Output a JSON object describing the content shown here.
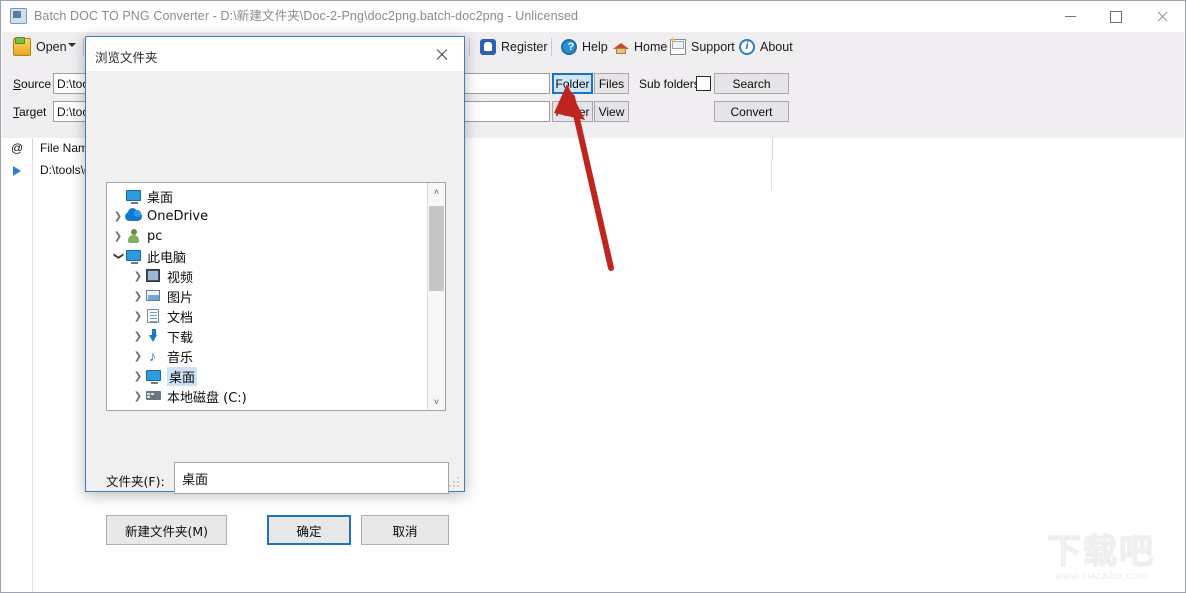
{
  "window": {
    "title": "Batch DOC TO PNG Converter - D:\\新建文件夹\\Doc-2-Png\\doc2png.batch-doc2png - Unlicensed",
    "app_icon": "app-icon",
    "controls": {
      "minimize": "minimize",
      "maximize": "maximize",
      "close": "close"
    }
  },
  "toolbar": {
    "open_label": "Open",
    "items": [
      {
        "label": "Register",
        "icon": "register-icon"
      },
      {
        "label": "Help",
        "icon": "help-icon"
      },
      {
        "label": "Home",
        "icon": "home-icon"
      },
      {
        "label": "Support",
        "icon": "support-icon"
      },
      {
        "label": "About",
        "icon": "about-icon"
      }
    ]
  },
  "params": {
    "source_label": "Source",
    "source_label_pre": "S",
    "source_label_post": "ource",
    "source_value": "D:\\tool",
    "target_label": "Target",
    "target_label_pre": "T",
    "target_label_post": "arget",
    "target_value": "D:\\tool",
    "source_folder_button": "Folder",
    "source_files_button": "Files",
    "subfolders_label": "Sub folders",
    "subfolders_checked": false,
    "search_button": "Search",
    "target_folder_button": "Folder",
    "view_button": "View",
    "convert_button": "Convert"
  },
  "file_list": {
    "columns": [
      "@",
      "File Name"
    ],
    "rows": [
      {
        "marker": "play-marker",
        "file_name": "D:\\tools\\g"
      }
    ]
  },
  "dialog": {
    "title": "浏览文件夹",
    "close_icon": "close-icon",
    "tree": [
      {
        "label": "桌面",
        "icon": "desktop-icon",
        "indent": 0,
        "expander": "none",
        "selected": false
      },
      {
        "label": "OneDrive",
        "icon": "cloud-icon",
        "indent": 1,
        "expander": "collapsed",
        "selected": false
      },
      {
        "label": "pc",
        "icon": "user-icon",
        "indent": 1,
        "expander": "collapsed",
        "selected": false
      },
      {
        "label": "此电脑",
        "icon": "computer-icon",
        "indent": 1,
        "expander": "expanded",
        "selected": false
      },
      {
        "label": "视频",
        "icon": "videos-icon",
        "indent": 2,
        "expander": "collapsed",
        "selected": false
      },
      {
        "label": "图片",
        "icon": "pictures-icon",
        "indent": 2,
        "expander": "collapsed",
        "selected": false
      },
      {
        "label": "文档",
        "icon": "documents-icon",
        "indent": 2,
        "expander": "collapsed",
        "selected": false
      },
      {
        "label": "下载",
        "icon": "downloads-icon",
        "indent": 2,
        "expander": "collapsed",
        "selected": false
      },
      {
        "label": "音乐",
        "icon": "music-icon",
        "indent": 2,
        "expander": "collapsed",
        "selected": false
      },
      {
        "label": "桌面",
        "icon": "desktop-icon",
        "indent": 2,
        "expander": "collapsed",
        "selected": true
      },
      {
        "label": "本地磁盘 (C:)",
        "icon": "disk-icon",
        "indent": 2,
        "expander": "collapsed",
        "selected": false
      }
    ],
    "scrollbar": {
      "up_arrow": "˄",
      "down_arrow": "˅"
    },
    "folder_label": "文件夹(F):",
    "folder_value": "桌面",
    "new_folder_button": "新建文件夹(M)",
    "ok_button": "确定",
    "cancel_button": "取消"
  },
  "annotation": {
    "arrow_color": "#c0241f",
    "points_to": "Folder"
  },
  "watermark": {
    "text": "下载吧",
    "url": "www.xiazaiba.com"
  },
  "colors": {
    "accent_blue": "#1f72bd",
    "toolbar_bg": "#f0eef1",
    "dialog_bg": "#f0f0f0",
    "selection": "#cde3f5"
  }
}
